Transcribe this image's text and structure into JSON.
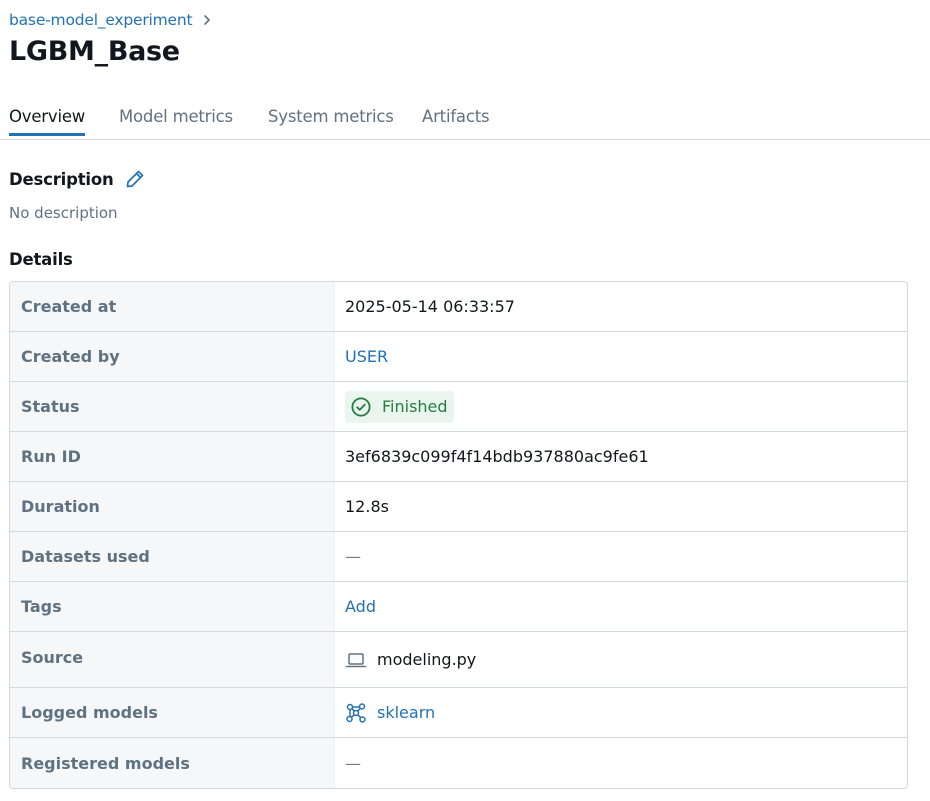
{
  "breadcrumb": {
    "experiment_label": "base-model_experiment"
  },
  "page": {
    "title": "LGBM_Base"
  },
  "tabs": [
    {
      "label": "Overview",
      "active": true
    },
    {
      "label": "Model metrics",
      "active": false
    },
    {
      "label": "System metrics",
      "active": false
    },
    {
      "label": "Artifacts",
      "active": false
    }
  ],
  "description": {
    "heading": "Description",
    "text": "No description"
  },
  "details": {
    "heading": "Details",
    "rows": [
      {
        "key": "Created at",
        "value": "2025-05-14 06:33:57"
      },
      {
        "key": "Created by",
        "value": "USER"
      },
      {
        "key": "Status",
        "value": "Finished"
      },
      {
        "key": "Run ID",
        "value": "3ef6839c099f4f14bdb937880ac9fe61"
      },
      {
        "key": "Duration",
        "value": "12.8s"
      },
      {
        "key": "Datasets used",
        "value": "—"
      },
      {
        "key": "Tags",
        "value": "Add"
      },
      {
        "key": "Source",
        "value": "modeling.py"
      },
      {
        "key": "Logged models",
        "value": "sklearn"
      },
      {
        "key": "Registered models",
        "value": "—"
      }
    ]
  },
  "icons": {
    "breadcrumb_separator": "chevron-right-icon",
    "edit_description": "pencil-icon",
    "status": "check-circle-icon",
    "source": "laptop-icon",
    "logged_model": "model-graph-icon"
  },
  "colors": {
    "link": "#2272b4",
    "status_text": "#277c43",
    "status_bg": "#eaf6ed",
    "key_text": "#5f7281"
  }
}
